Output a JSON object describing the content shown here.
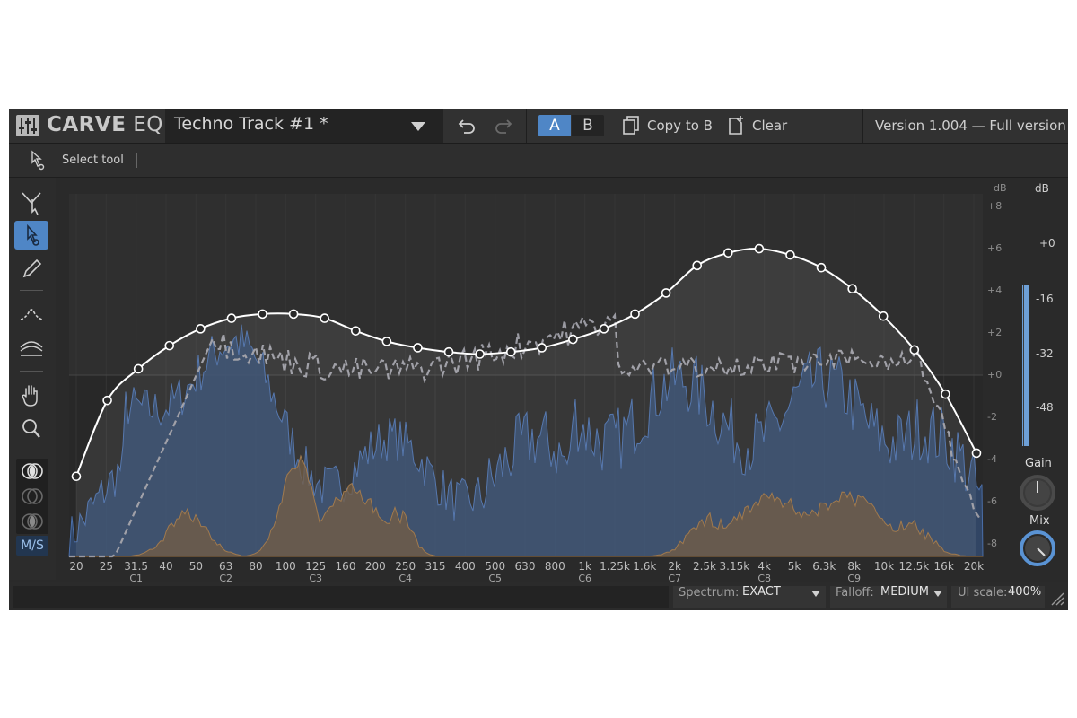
{
  "app": {
    "logo_bold": "CARVE",
    "logo_light": " EQ",
    "preset_name": "Techno Track #1 *",
    "ab_a": "A",
    "ab_b": "B",
    "copy_label": "Copy to B",
    "clear_label": "Clear",
    "version": "Version 1.004 — Full version"
  },
  "toolbar": {
    "current_tool_label": "Select tool"
  },
  "left_tools": {
    "ms_label": "M/S"
  },
  "graph": {
    "db_unit": "dB",
    "db_ticks": [
      "+8",
      "+6",
      "+4",
      "+2",
      "+0",
      "-2",
      "-4",
      "-6",
      "-8"
    ],
    "freq_ticks": [
      "20",
      "25",
      "31.5",
      "40",
      "50",
      "63",
      "80",
      "100",
      "125",
      "160",
      "200",
      "250",
      "315",
      "400",
      "500",
      "630",
      "800",
      "1k",
      "1.25k",
      "1.6k",
      "2k",
      "2.5k",
      "3.15k",
      "4k",
      "5k",
      "6.3k",
      "8k",
      "10k",
      "12.5k",
      "16k",
      "20k"
    ],
    "notes": [
      "C1",
      "C2",
      "C3",
      "C4",
      "C5",
      "C6",
      "C7",
      "C8",
      "C9"
    ]
  },
  "meter": {
    "unit": "dB",
    "ticks": [
      "+0",
      "-16",
      "-32",
      "-48"
    ],
    "gain_label": "Gain",
    "mix_label": "Mix",
    "gain_value": 0.5,
    "mix_value": 1.0
  },
  "status": {
    "spectrum_label": "Spectrum:",
    "spectrum_value": "EXACT",
    "falloff_label": "Falloff:",
    "falloff_value": "MEDIUM",
    "ui_scale_label": "UI scale:",
    "ui_scale_value": "400%"
  },
  "eq_curve_db": [
    -4.8,
    -1.2,
    0.3,
    1.4,
    2.2,
    2.7,
    2.9,
    2.9,
    2.7,
    2.1,
    1.6,
    1.3,
    1.1,
    1.0,
    1.1,
    1.3,
    1.7,
    2.2,
    2.9,
    3.9,
    5.2,
    5.8,
    6.0,
    5.7,
    5.1,
    4.1,
    2.8,
    1.2,
    -0.9,
    -3.7
  ],
  "colors": {
    "accent": "#4f86c6",
    "curve": "#ffffff",
    "spectrum_blue": "#3a5f9a",
    "spectrum_orange": "#9a7040",
    "dashed_curve": "#9a9aa2"
  }
}
